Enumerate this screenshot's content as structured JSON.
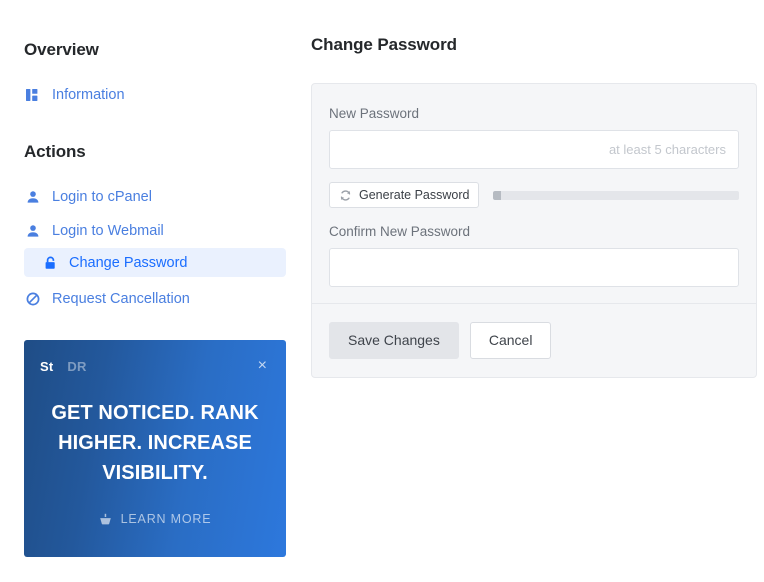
{
  "sidebar": {
    "overview_heading": "Overview",
    "actions_heading": "Actions",
    "overview_items": [
      {
        "label": "Information",
        "icon": "dashboard-grid-icon"
      }
    ],
    "action_items": [
      {
        "label": "Login to cPanel",
        "icon": "user-icon"
      },
      {
        "label": "Login to Webmail",
        "icon": "user-icon"
      },
      {
        "label": "Change Password",
        "icon": "lock-icon",
        "active": true
      },
      {
        "label": "Request Cancellation",
        "icon": "ban-icon"
      }
    ]
  },
  "ad": {
    "brand_primary": "St",
    "brand_secondary": "DR",
    "close_label": "×",
    "headline": "GET NOTICED. RANK HIGHER. INCREASE VISIBILITY.",
    "cta_label": "LEARN MORE",
    "cta_icon": "basket-icon",
    "gradient_start": "#1f4d86",
    "gradient_end": "#2d78dd"
  },
  "main": {
    "title": "Change Password",
    "new_password": {
      "label": "New Password",
      "value": "",
      "placeholder": "at least 5 characters"
    },
    "generate": {
      "label": "Generate Password",
      "icon": "refresh-sync-icon"
    },
    "strength": {
      "percent": 3
    },
    "confirm_password": {
      "label": "Confirm New Password",
      "value": "",
      "placeholder": ""
    },
    "save_label": "Save Changes",
    "cancel_label": "Cancel"
  },
  "colors": {
    "link_blue": "#4a7fe0",
    "active_blue": "#1a6dff",
    "active_bg": "#eaf1fe",
    "card_bg": "#f5f6f8",
    "text_dark": "#25282b"
  }
}
